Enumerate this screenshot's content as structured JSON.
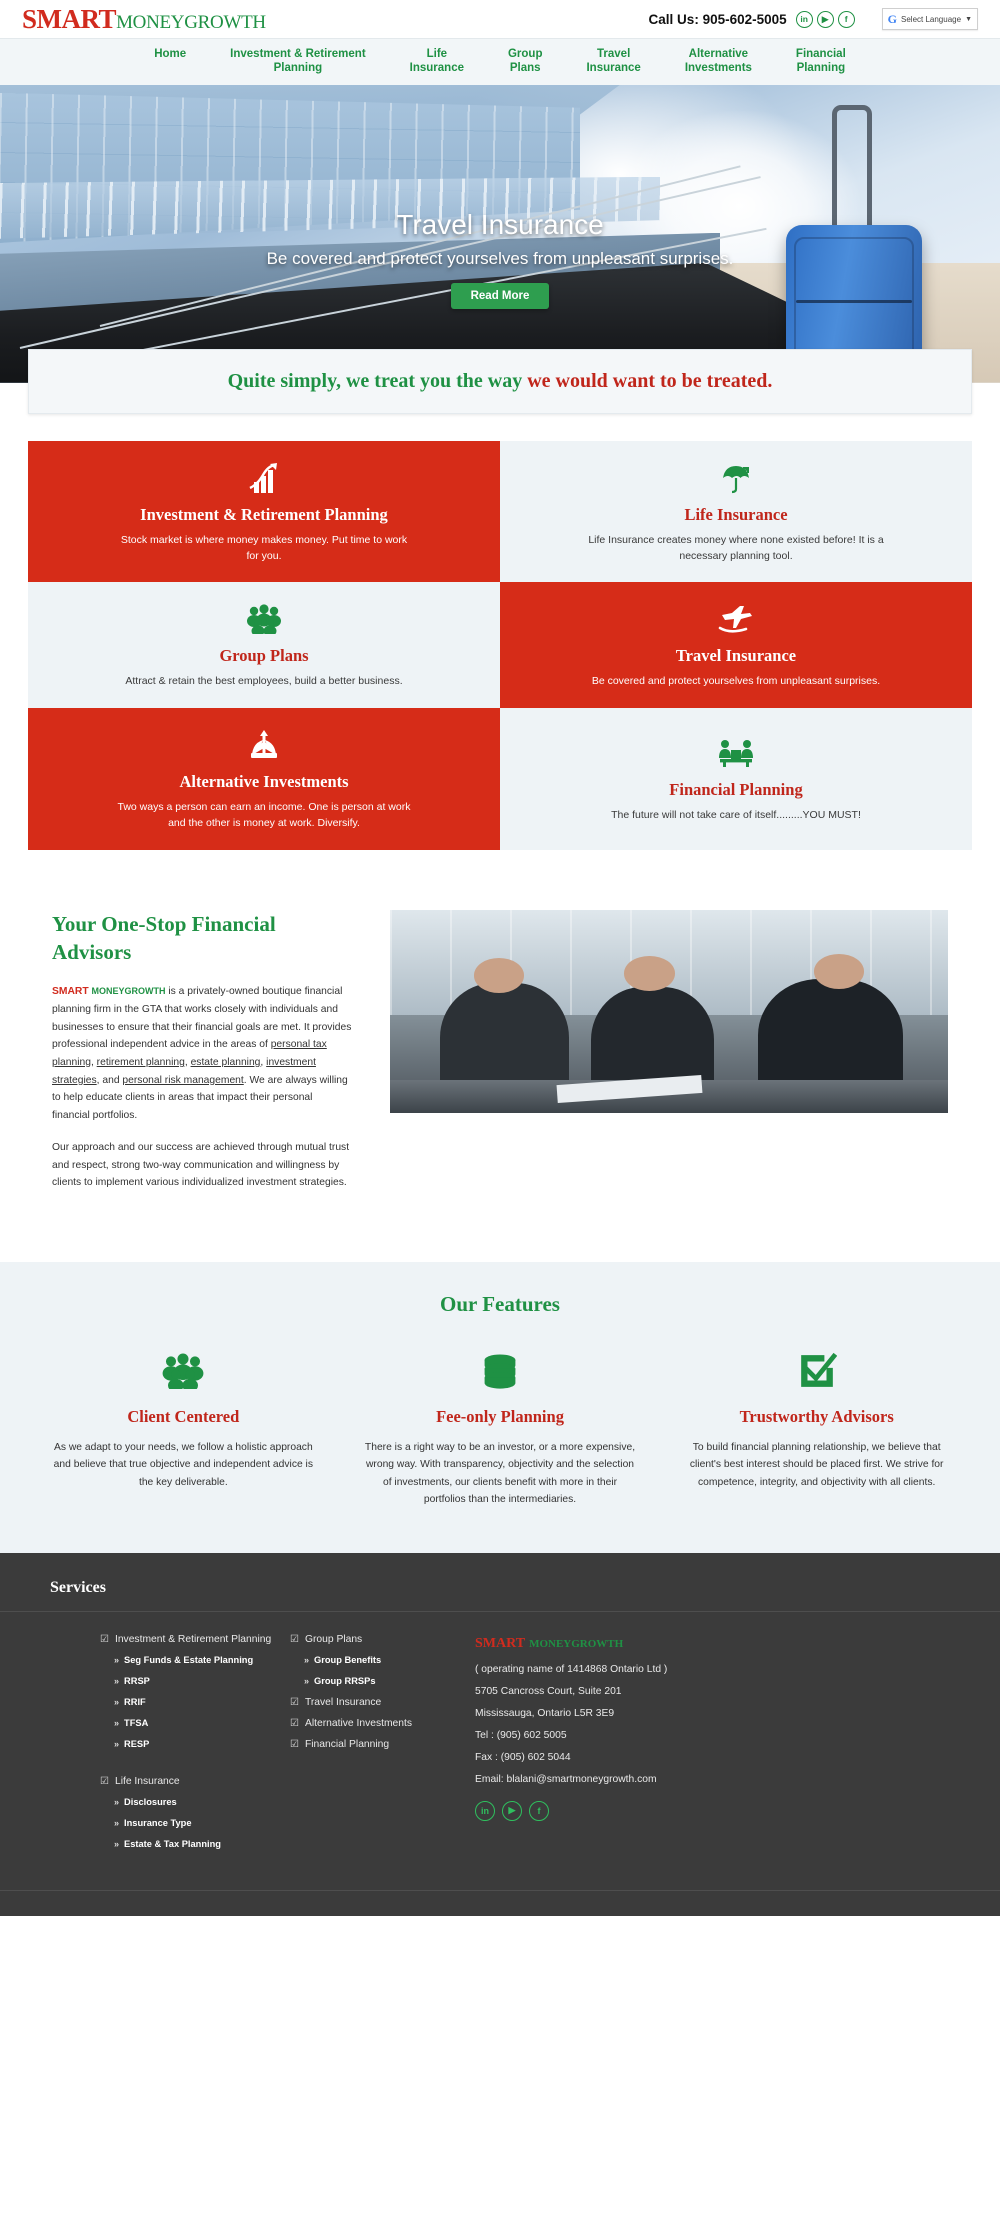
{
  "header": {
    "logo": {
      "part1": "SMART",
      "part2": "MONEYGROWTH"
    },
    "call_label": "Call Us:",
    "phone": "905-602-5005",
    "social": [
      {
        "name": "linkedin-icon",
        "glyph": "in"
      },
      {
        "name": "youtube-icon",
        "glyph": "▶"
      },
      {
        "name": "facebook-icon",
        "glyph": "f"
      }
    ],
    "language": {
      "g": "G",
      "label": "Select Language",
      "caret": "▼"
    }
  },
  "nav": {
    "items": [
      "Home",
      "Investment & Retirement\nPlanning",
      "Life\nInsurance",
      "Group\nPlans",
      "Travel\nInsurance",
      "Alternative\nInvestments",
      "Financial\nPlanning"
    ]
  },
  "hero": {
    "title": "Travel Insurance",
    "subtitle": "Be covered and protect yourselves from unpleasant surprises.",
    "button": "Read More"
  },
  "tagline": {
    "green": "Quite simply, we treat you the way ",
    "red": "we would want to be treated."
  },
  "cards": [
    {
      "title": "Investment & Retirement Planning",
      "desc": "Stock market is where money makes money. Put time to work for you.",
      "style": "red",
      "icon": "bar-chart-growth-icon"
    },
    {
      "title": "Life Insurance",
      "desc": "Life Insurance creates money where none existed before! It is a necessary planning tool.",
      "style": "light",
      "icon": "umbrella-shield-icon"
    },
    {
      "title": "Group Plans",
      "desc": "Attract & retain the best employees, build a better business.",
      "style": "light",
      "icon": "people-group-icon"
    },
    {
      "title": "Travel Insurance",
      "desc": "Be covered and protect yourselves from unpleasant surprises.",
      "style": "red",
      "icon": "airplane-hand-icon"
    },
    {
      "title": "Alternative Investments",
      "desc": "Two ways a person can earn an income. One is person at work and the other is money at work. Diversify.",
      "style": "red",
      "icon": "crown-arrows-icon"
    },
    {
      "title": "Financial Planning",
      "desc": "The future will not take care of itself.........YOU MUST!",
      "style": "light",
      "icon": "desk-meeting-icon"
    }
  ],
  "about": {
    "heading": "Your One-Stop Financial Advisors",
    "brand_red": "SMART",
    "brand_green": "MONEYGROWTH",
    "para1_a": " is a privately-owned boutique financial planning firm in the GTA that works closely with individuals and businesses to ensure that their financial goals are met. It provides professional independent advice in the areas of ",
    "link1": "personal tax planning",
    "sep1": ", ",
    "link2": "retirement planning",
    "sep2": ", ",
    "link3": "estate planning",
    "sep3": ", ",
    "link4": "investment strategies",
    "sep4": ", and ",
    "link5": "personal risk management",
    "para1_b": ". We are always willing to help educate clients in areas that impact their personal financial portfolios.",
    "para2": "Our approach and our success are achieved through mutual trust and respect, strong two-way communication and willingness by clients to implement various individualized investment strategies."
  },
  "features": {
    "heading": "Our Features",
    "items": [
      {
        "title": "Client Centered",
        "desc": "As we adapt to your needs, we follow a holistic approach and believe that true objective and independent advice is the key deliverable.",
        "icon": "people-group-icon"
      },
      {
        "title": "Fee-only Planning",
        "desc": "There is a right way to be an investor, or a more expensive, wrong way. With transparency, objectivity and the selection of investments, our clients benefit with more in their portfolios than the intermediaries.",
        "icon": "coins-stack-icon"
      },
      {
        "title": "Trustworthy Advisors",
        "desc": "To build financial planning relationship, we believe that client's best interest should be placed first. We strive for competence, integrity, and objectivity with all clients.",
        "icon": "checkbox-check-icon"
      }
    ]
  },
  "footer": {
    "services_heading": "Services",
    "col1": [
      {
        "type": "head",
        "label": "Investment & Retirement Planning"
      },
      {
        "type": "sub",
        "label": "Seg Funds & Estate Planning"
      },
      {
        "type": "sub",
        "label": "RRSP"
      },
      {
        "type": "sub",
        "label": "RRIF"
      },
      {
        "type": "sub",
        "label": "TFSA"
      },
      {
        "type": "sub",
        "label": "RESP"
      },
      {
        "type": "gap",
        "label": ""
      },
      {
        "type": "head",
        "label": "Life Insurance"
      },
      {
        "type": "sub",
        "label": "Disclosures"
      },
      {
        "type": "sub",
        "label": "Insurance Type"
      },
      {
        "type": "sub",
        "label": "Estate & Tax Planning"
      }
    ],
    "col2": [
      {
        "type": "head",
        "label": "Group Plans"
      },
      {
        "type": "sub",
        "label": "Group Benefits"
      },
      {
        "type": "sub",
        "label": "Group RRSPs"
      },
      {
        "type": "head",
        "label": "Travel Insurance"
      },
      {
        "type": "head",
        "label": "Alternative Investments"
      },
      {
        "type": "head",
        "label": "Financial Planning"
      }
    ],
    "brand_red": "SMART",
    "brand_green": "MONEYGROWTH",
    "address_lines": [
      "( operating name of 1414868 Ontario Ltd )",
      "5705 Cancross Court, Suite 201",
      "Mississauga, Ontario L5R 3E9",
      "Tel : (905) 602 5005",
      "Fax : (905) 602 5044",
      "Email: blalani@smartmoneygrowth.com"
    ],
    "social": [
      {
        "name": "linkedin-icon",
        "glyph": "in"
      },
      {
        "name": "youtube-icon",
        "glyph": "▶"
      },
      {
        "name": "facebook-icon",
        "glyph": "f"
      }
    ]
  }
}
